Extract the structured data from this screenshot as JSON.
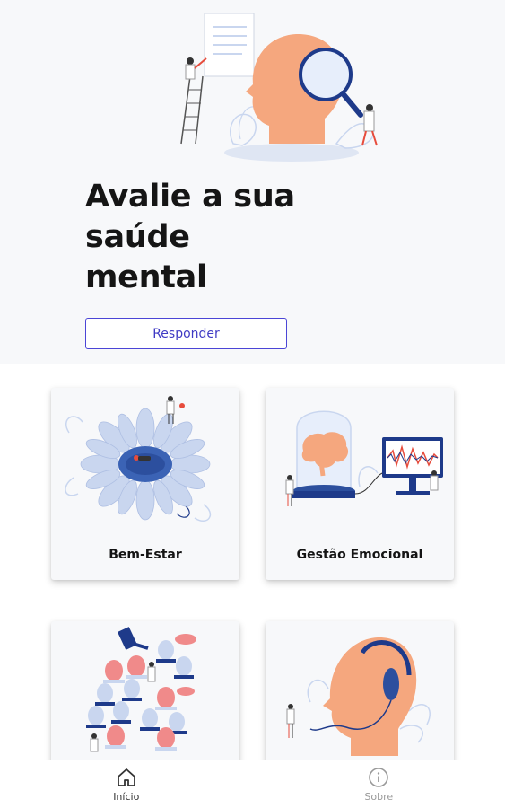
{
  "hero": {
    "title_line1": "Avalie a sua",
    "title_line2": "saúde",
    "title_line3": "mental",
    "button_label": "Responder"
  },
  "cards": [
    {
      "label": "Bem-Estar",
      "icon": "flower-meditation-illustration"
    },
    {
      "label": "Gestão Emocional",
      "icon": "brain-jar-monitor-illustration"
    },
    {
      "label": "",
      "icon": "gavel-brain-jars-illustration"
    },
    {
      "label": "",
      "icon": "head-headphones-illustration"
    }
  ],
  "nav": {
    "home_label": "Início",
    "about_label": "Sobre"
  },
  "colors": {
    "accent": "#4b45d6",
    "skin": "#f5a77e",
    "navy": "#1e3a8a",
    "light_blue": "#c9d6ef",
    "coral": "#f08a8a"
  }
}
